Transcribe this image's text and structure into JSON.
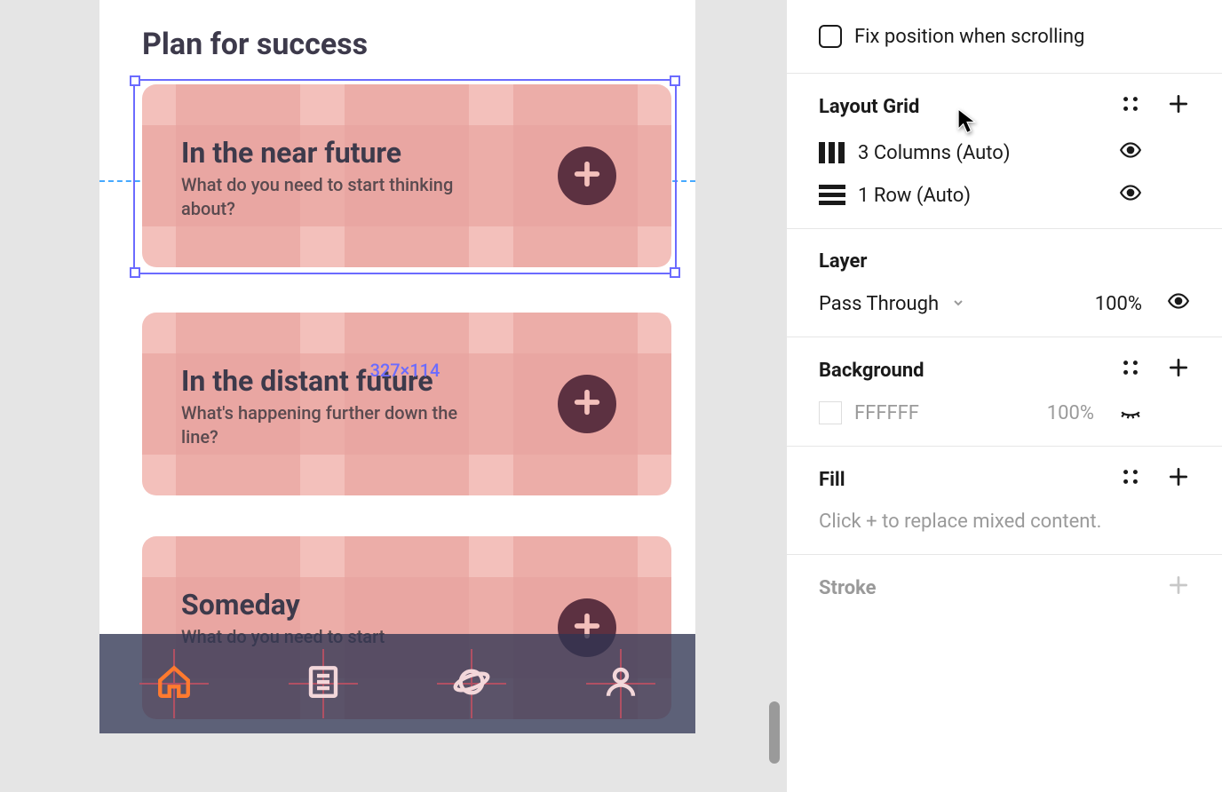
{
  "canvas": {
    "page_title": "Plan for success",
    "selection_size": "327×114",
    "cards": [
      {
        "title": "In the near future",
        "sub": "What do you need to start thinking about?"
      },
      {
        "title": "In the distant future",
        "sub": "What's happening further down the line?"
      },
      {
        "title": "Someday",
        "sub": "What do you need to start"
      }
    ]
  },
  "panel": {
    "fix_position_label": "Fix position when scrolling",
    "layout_grid": {
      "title": "Layout Grid",
      "items": [
        {
          "label": "3 Columns (Auto)"
        },
        {
          "label": "1 Row (Auto)"
        }
      ]
    },
    "layer": {
      "title": "Layer",
      "blend": "Pass Through",
      "opacity": "100%"
    },
    "background": {
      "title": "Background",
      "hex": "FFFFFF",
      "opacity": "100%"
    },
    "fill": {
      "title": "Fill",
      "placeholder": "Click + to replace mixed content."
    },
    "stroke": {
      "title": "Stroke"
    }
  }
}
